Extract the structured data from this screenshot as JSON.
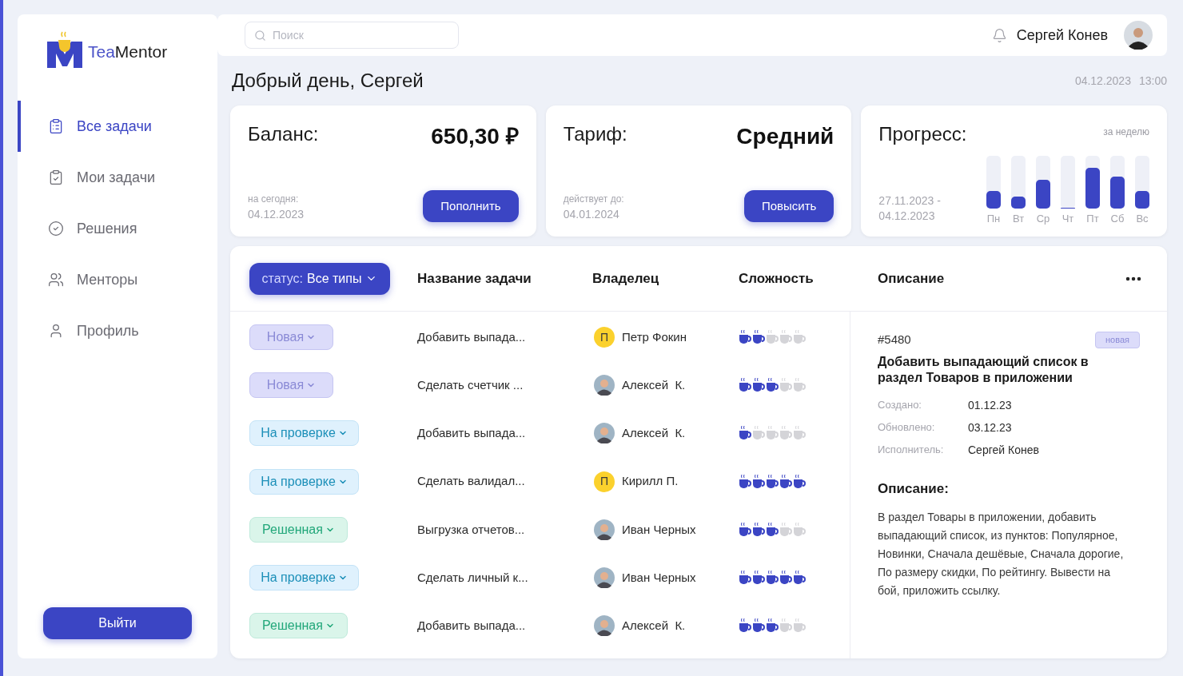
{
  "logo": {
    "part_1": "Tea",
    "part_2": "Mentor"
  },
  "sidebar": {
    "items": [
      {
        "label": "Все задачи",
        "selected": true
      },
      {
        "label": "Мои задачи",
        "selected": false
      },
      {
        "label": "Решения",
        "selected": false
      },
      {
        "label": "Менторы",
        "selected": false
      },
      {
        "label": "Профиль",
        "selected": false
      }
    ],
    "logout": "Выйти"
  },
  "search": {
    "placeholder": "Поиск"
  },
  "user": {
    "name": "Сергей Конев"
  },
  "greeting": "Добрый день, Сергей",
  "datetime": {
    "date": "04.12.2023",
    "time": "13:00"
  },
  "cards": [
    {
      "kind": "balance",
      "title": "Баланс:",
      "value": "650,30 ₽",
      "caption": "на сегодня:",
      "date": "04.12.2023",
      "button": "Пополнить"
    },
    {
      "kind": "plan",
      "title": "Тариф:",
      "value": "Средний",
      "caption": "действует до:",
      "date": "04.01.2024",
      "button": "Повысить"
    },
    {
      "kind": "progress",
      "title": "Прогресс:",
      "period_label": "за неделю",
      "range_start": "27.11.2023 -",
      "range_end": "04.12.2023",
      "days": [
        {
          "label": "Пн",
          "level": 0.33
        },
        {
          "label": "Вт",
          "level": 0.22
        },
        {
          "label": "Ср",
          "level": 0.55
        },
        {
          "label": "Чт",
          "level": 0
        },
        {
          "label": "Пт",
          "level": 0.78
        },
        {
          "label": "Сб",
          "level": 0.6
        },
        {
          "label": "Вс",
          "level": 0.33
        }
      ]
    }
  ],
  "table": {
    "filter": {
      "label": "статус:",
      "value": "Все типы"
    },
    "columns": [
      "Название задачи",
      "Владелец",
      "Сложность",
      "Описание"
    ],
    "rows": [
      {
        "status": {
          "label": "Новая",
          "kind": "new"
        },
        "title": "Добавить выпада...",
        "owner": {
          "name": "Петр Фокин",
          "kind": "letter",
          "initial": "П"
        },
        "stars": 2
      },
      {
        "status": {
          "label": "Новая",
          "kind": "new"
        },
        "title": "Сделать счетчик ...",
        "owner": {
          "name": "Алексей  К.",
          "kind": "photo"
        },
        "stars": 3
      },
      {
        "status": {
          "label": "На проверке",
          "kind": "review"
        },
        "title": "Добавить выпада...",
        "owner": {
          "name": "Алексей  К.",
          "kind": "photo"
        },
        "stars": 1
      },
      {
        "status": {
          "label": "На проверке",
          "kind": "review"
        },
        "title": "Сделать валидал...",
        "owner": {
          "name": "Кирилл П.",
          "kind": "letter",
          "initial": "П"
        },
        "stars": 5
      },
      {
        "status": {
          "label": "Решенная",
          "kind": "done"
        },
        "title": "Выгрузка отчетов...",
        "owner": {
          "name": "Иван Черных",
          "kind": "photo"
        },
        "stars": 3
      },
      {
        "status": {
          "label": "На проверке",
          "kind": "review"
        },
        "title": "Сделать личный к...",
        "owner": {
          "name": "Иван Черных",
          "kind": "photo"
        },
        "stars": 5
      },
      {
        "status": {
          "label": "Решенная",
          "kind": "done"
        },
        "title": "Добавить выпада...",
        "owner": {
          "name": "Алексей  К.",
          "kind": "photo"
        },
        "stars": 3
      }
    ]
  },
  "detail": {
    "id": "#5480",
    "tag": "новая",
    "title": "Добавить выпадающий список в раздел Товаров в приложении",
    "fields": [
      {
        "label": "Создано:",
        "value": "01.12.23"
      },
      {
        "label": "Обновлено:",
        "value": "03.12.23"
      },
      {
        "label": "Исполнитель:",
        "value": "Сергей Конев"
      }
    ],
    "description_heading": "Описание:",
    "description": "В раздел Товары в приложении, добавить выпадающий список, из пунктов: Популярное, Новинки, Сначала дешёвые, Сначала дорогие, По размеру скидки, По рейтингу. Вывести на бой, приложить ссылку."
  }
}
